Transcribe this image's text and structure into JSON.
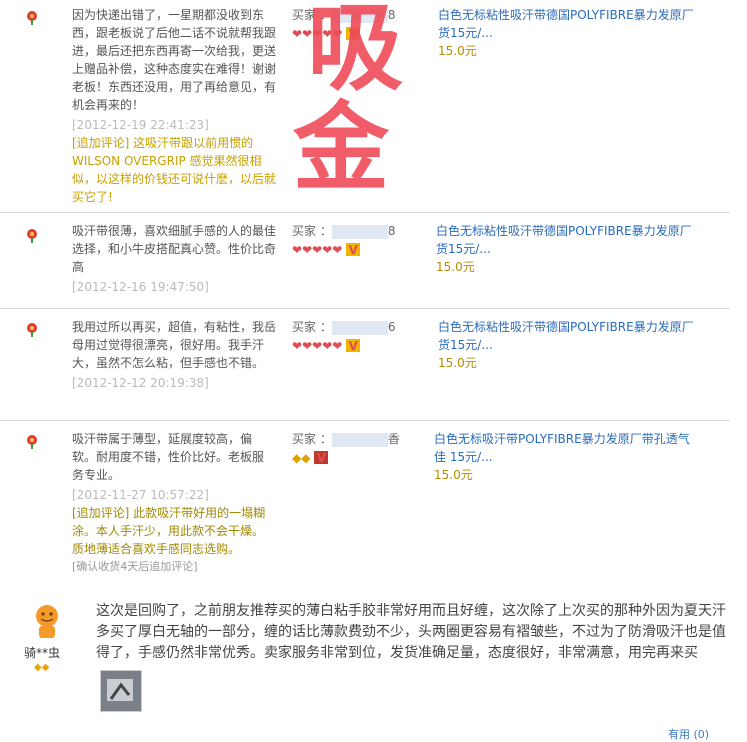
{
  "buyer_label": "买家 ：",
  "reviews": [
    {
      "comment": "因为快递出错了，一星期都没收到东西，跟老板说了后他二话不说就帮我跟进，最后还把东西再寄一次给我，更送上赠品补偿，这种态度实在难得！谢谢老板！东西还没用，用了再给意见，有机会再来的！",
      "time": "[2012-12-19 22:41:23]",
      "followup": "[追加评论] 这吸汗带跟以前用惯的WILSON OVERGRIP 感觉果然很相似，以这样的价钱还可说什麽，以后就买它了!",
      "buyer_suffix": "8",
      "product": "白色无标粘性吸汗带德国POLYFIBRE暴力发原厂货15元/...",
      "price": "15.0元"
    },
    {
      "comment": "吸汗带很薄，喜欢细腻手感的人的最佳选择，和小牛皮搭配真心赞。性价比奇高",
      "time": "[2012-12-16 19:47:50]",
      "buyer_suffix": "8",
      "product": "白色无标粘性吸汗带德国POLYFIBRE暴力发原厂货15元/...",
      "price": "15.0元"
    },
    {
      "comment": "我用过所以再买，超值，有粘性，我岳母用过觉得很漂亮，很好用。我手汗大，虽然不怎么粘，但手感也不错。",
      "time": "[2012-12-12 20:19:38]",
      "buyer_suffix": "6",
      "product": "白色无标粘性吸汗带德国POLYFIBRE暴力发原厂货15元/...",
      "price": "15.0元"
    },
    {
      "comment": "吸汗带属于薄型，延展度较高，偏软。耐用度不错，性价比好。老板服务专业。",
      "time": "[2012-11-27 10:57:22]",
      "followup": "[追加评论] 此款吸汗带好用的一塌糊涂。本人手汗少，用此款不会干燥。质地薄适合喜欢手感同志选购。",
      "note": "[确认收货4天后追加评论]",
      "buyer_suffix": "香",
      "product": "白色无标吸汗带POLYFIBRE暴力发原厂带孔透气佳 15元/...",
      "price": "15.0元"
    }
  ],
  "stamp_chars": [
    "吸",
    "金"
  ],
  "big_review": {
    "user": "骑**虫",
    "text": "这次是回购了，之前朋友推荐买的薄白粘手胶非常好用而且好缠，这次除了上次买的那种外因为夏天汗多买了厚白无轴的一部分，缠的话比薄款费劲不少，头两圈更容易有褶皱些，不过为了防滑吸汗也是值得了，手感仍然非常优秀。卖家服务非常到位，发货准确足量，态度很好，非常满意，用完再来买",
    "bottom_right": "有用 (0)"
  },
  "colors": {
    "link": "#2a6bbd",
    "price": "#b58c00",
    "followup": "#c8a000",
    "stamp": "#ef4b58",
    "heart": "#e04c55"
  }
}
